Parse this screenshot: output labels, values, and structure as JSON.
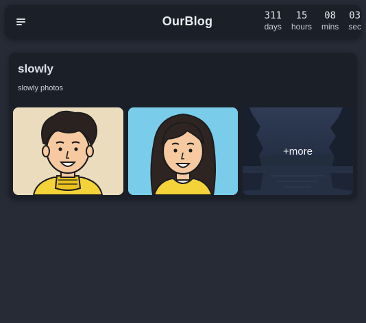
{
  "header": {
    "menu_icon": "menu-icon",
    "title": "OurBlog",
    "countdown": [
      {
        "value": "311",
        "label": "days"
      },
      {
        "value": "15",
        "label": "hours"
      },
      {
        "value": "08",
        "label": "mins"
      },
      {
        "value": "03",
        "label": "sec"
      }
    ]
  },
  "card": {
    "title": "slowly",
    "description": "slowly photos",
    "photos": [
      {
        "kind": "avatar-boy"
      },
      {
        "kind": "avatar-girl"
      },
      {
        "kind": "landscape-lake",
        "overlay": "+more"
      }
    ]
  },
  "colors": {
    "background": "#262b36",
    "surface": "#1b1f27",
    "photo1_bg": "#ebdcbe",
    "photo2_bg": "#79cdea"
  }
}
